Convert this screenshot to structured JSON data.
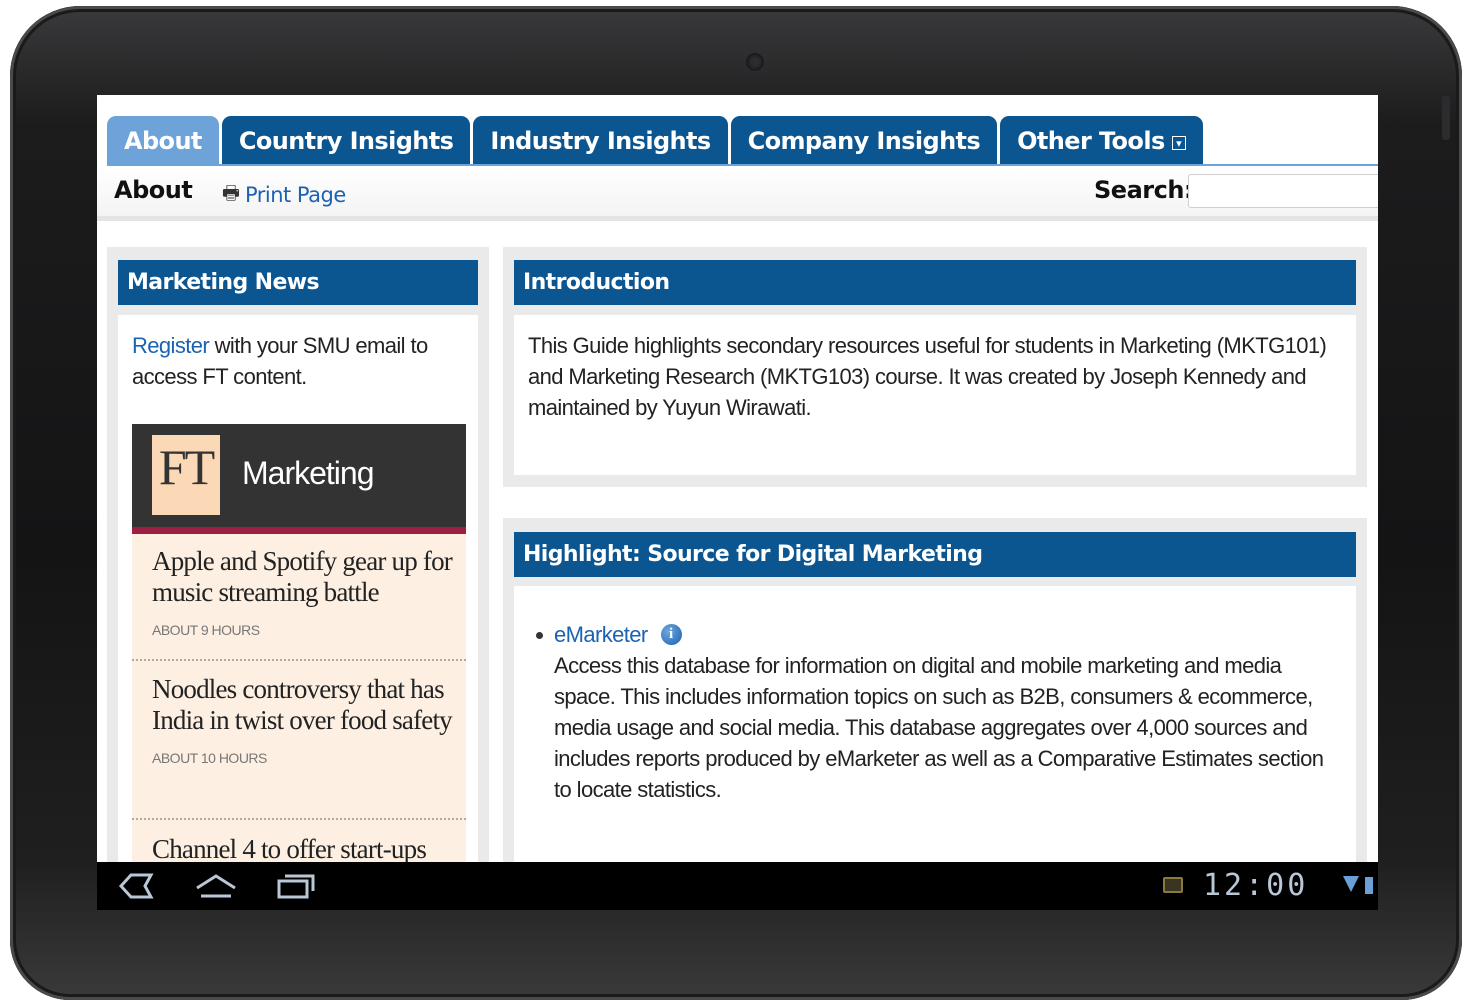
{
  "tabs": [
    {
      "label": "About",
      "active": true
    },
    {
      "label": "Country Insights",
      "active": false
    },
    {
      "label": "Industry Insights",
      "active": false
    },
    {
      "label": "Company Insights",
      "active": false
    },
    {
      "label": "Other Tools",
      "active": false,
      "dropdown": true
    }
  ],
  "subheader": {
    "page_title": "About",
    "print_label": "Print Page",
    "search_label": "Search:",
    "search_value": ""
  },
  "marketing_news": {
    "title": "Marketing News",
    "register_link": "Register",
    "register_text": " with your SMU email to access FT content.",
    "ft": {
      "logo": "FT",
      "section": "Marketing",
      "items": [
        {
          "headline": "Apple and Spotify gear up for music streaming battle",
          "time": "ABOUT 9 HOURS"
        },
        {
          "headline": "Noodles controversy that has India in twist over food safety",
          "time": "ABOUT 10 HOURS"
        },
        {
          "headline": "Channel 4 to offer start-ups",
          "time": ""
        }
      ]
    }
  },
  "introduction": {
    "title": "Introduction",
    "body": "This Guide highlights secondary resources useful for students in Marketing (MKTG101) and Marketing Research (MKTG103) course.  It was created by Joseph Kennedy and maintained by Yuyun Wirawati."
  },
  "highlight": {
    "title": "Highlight: Source for Digital Marketing",
    "resource_link": "eMarketer",
    "info_icon": "i",
    "description": "Access this database for information on digital and mobile marketing and media space. This includes information topics on such as B2B, consumers & ecommerce, media usage and social media. This database aggregates over 4,000 sources and includes reports produced by eMarketer as well as a Comparative Estimates section to locate statistics."
  },
  "status_bar": {
    "clock": "12:00"
  },
  "colors": {
    "tab_blue": "#0b5591",
    "tab_active": "#6da3d8",
    "link": "#1c62b3",
    "ft_accent": "#9e1f44"
  }
}
